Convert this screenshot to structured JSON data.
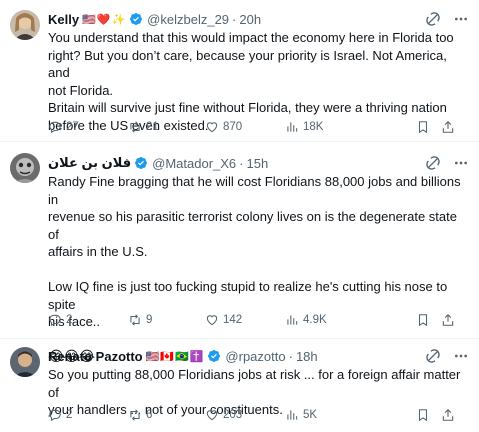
{
  "tweets": [
    {
      "name": "Kelly",
      "flags": "🇺🇸❤️✨",
      "handle": "@kelzbelz_29",
      "time": "20h",
      "lines": [
        "You understand that this would impact the economy here in Florida too",
        "right? But you don’t care, because your priority is Israel. Not America, and",
        "not Florida.",
        "Britain will survive just fine without Florida, they were a thriving nation",
        "before the US even existed."
      ],
      "replies": "27",
      "retweets": "21",
      "likes": "870",
      "views": "18K"
    },
    {
      "name": "فلان بن علان",
      "flags": "",
      "handle": "@Matador_X6",
      "time": "15h",
      "lines": [
        "Randy Fine bragging that he will cost Floridians 88,000 jobs and billions in",
        "revenue so his parasitic terrorist colony lives on is the degenerate state of",
        "affairs in the U.S.",
        "",
        "Low IQ fine is just too fucking stupid to realize he's cutting his nose to spite",
        "his face.."
      ],
      "emojis": "😂😂😂",
      "replies": "2",
      "retweets": "9",
      "likes": "142",
      "views": "4.9K"
    },
    {
      "name": "Renato Pazotto",
      "flags": "🇺🇸🇨🇦🇧🇷✝️",
      "handle": "@rpazotto",
      "time": "18h",
      "lines": [
        "So you putting 88,000 Floridians jobs at risk ... for a foreign affair matter of",
        "your handlers  ... not of your constituents."
      ],
      "replies": "2",
      "retweets": "6",
      "likes": "203",
      "views": "5K"
    }
  ],
  "colors": {
    "verified": "#1d9bf0",
    "muted": "#536471",
    "text": "#0f1419",
    "divider": "#eff3f4"
  },
  "icons": [
    "verified-badge-icon",
    "grok-icon",
    "more-icon",
    "reply-icon",
    "retweet-icon",
    "like-icon",
    "views-icon",
    "bookmark-icon",
    "share-icon"
  ]
}
